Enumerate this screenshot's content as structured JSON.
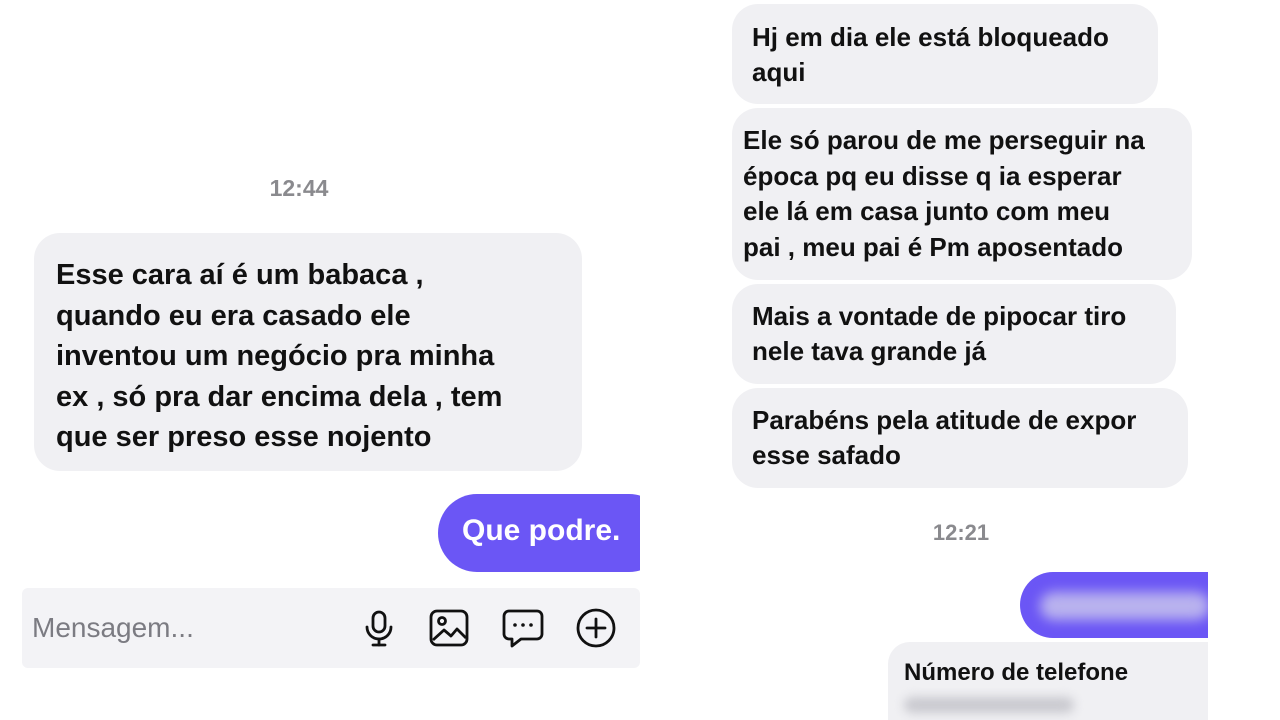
{
  "left": {
    "timestamp": "12:44",
    "incoming_message": {
      "lines": [
        "Esse cara aí é um babaca ,",
        "quando eu era casado ele",
        "inventou um negócio pra minha",
        "ex , só pra dar encima dela , tem",
        "que ser preso esse nojento"
      ]
    },
    "outgoing_message": "Que podre.",
    "composer": {
      "placeholder": "Mensagem...",
      "icons": [
        "microphone-icon",
        "image-icon",
        "chat-icon",
        "plus-circle-icon"
      ]
    }
  },
  "right": {
    "messages": [
      {
        "lines": [
          "Hj em dia ele está bloqueado",
          "aqui"
        ]
      },
      {
        "lines": [
          "Ele só parou de me perseguir na",
          "época pq eu disse q ia esperar",
          "ele lá em casa junto com meu",
          "pai , meu pai é Pm aposentado"
        ]
      },
      {
        "lines": [
          "Mais a vontade de pipocar tiro",
          "nele tava grande já"
        ]
      },
      {
        "lines": [
          "Parabéns pela atitude de expor",
          "esse safado"
        ]
      }
    ],
    "timestamp": "12:21",
    "contact_card": {
      "title": "Número de telefone"
    }
  },
  "colors": {
    "outgoing_bubble": "#6b56f5",
    "incoming_bubble": "#f0f0f3",
    "timestamp": "#8a8a8e"
  }
}
